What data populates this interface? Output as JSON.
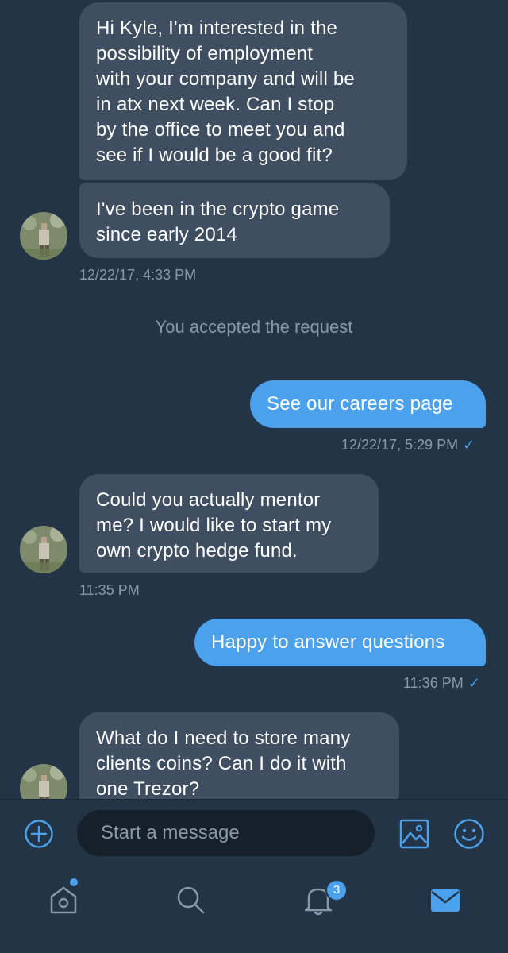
{
  "messages": [
    {
      "direction": "incoming",
      "text": "Hi Kyle, I'm interested in the possibility of employment with your company and will be in atx next week. Can I stop by the office to meet you and see if I would be a good fit?"
    },
    {
      "direction": "incoming",
      "text": "I've been in the crypto game since early 2014"
    },
    {
      "direction": "incoming",
      "timestamp": "12/22/17, 4:33 PM"
    },
    {
      "direction": "system",
      "text": "You accepted the request"
    },
    {
      "direction": "outgoing",
      "text": "See our careers page",
      "timestamp": "12/22/17, 5:29 PM"
    },
    {
      "direction": "incoming",
      "text": "Could you actually mentor me? I would like to start my own crypto hedge fund.",
      "timestamp": "11:35 PM"
    },
    {
      "direction": "outgoing",
      "text": "Happy to answer questions",
      "timestamp": "11:36 PM"
    },
    {
      "direction": "incoming",
      "text": "What do I need to store many clients coins? Can I do it with one Trezor?"
    }
  ],
  "bubbles": {
    "m1_lines": [
      "Hi Kyle, I'm interested in the",
      "possibility of employment",
      "with your company and will be",
      "in atx next week. Can I stop",
      "by the office to meet you and",
      "see if I would be a good fit?"
    ],
    "m2_lines": [
      "I've been in the crypto game",
      "since early 2014"
    ],
    "m2_time": "12/22/17, 4:33 PM",
    "system": "You accepted the request",
    "m3": "See our careers page",
    "m3_time": "12/22/17, 5:29 PM",
    "m4_lines": [
      "Could you actually mentor",
      "me? I would like to start my",
      "own crypto hedge fund."
    ],
    "m4_time": "11:35 PM",
    "m5": "Happy to answer questions",
    "m5_time": "11:36 PM",
    "m6_lines": [
      "What do I need to store many",
      "clients coins? Can I do it with",
      "one Trezor?"
    ]
  },
  "composer": {
    "placeholder": "Start a message",
    "left_icon": "plus-circle-icon",
    "right_icons": [
      "image-icon",
      "emoji-icon"
    ]
  },
  "nav": {
    "items": [
      "home-icon",
      "search-icon",
      "notifications-icon",
      "messages-icon"
    ],
    "notification_count": "3",
    "active": "messages-icon"
  },
  "colors": {
    "background": "#243447",
    "incoming_bubble": "#3f4f61",
    "outgoing_bubble": "#4ba1ec",
    "meta_text": "#8899a6",
    "accent": "#4ba1ec",
    "input_bg": "#15202b"
  }
}
